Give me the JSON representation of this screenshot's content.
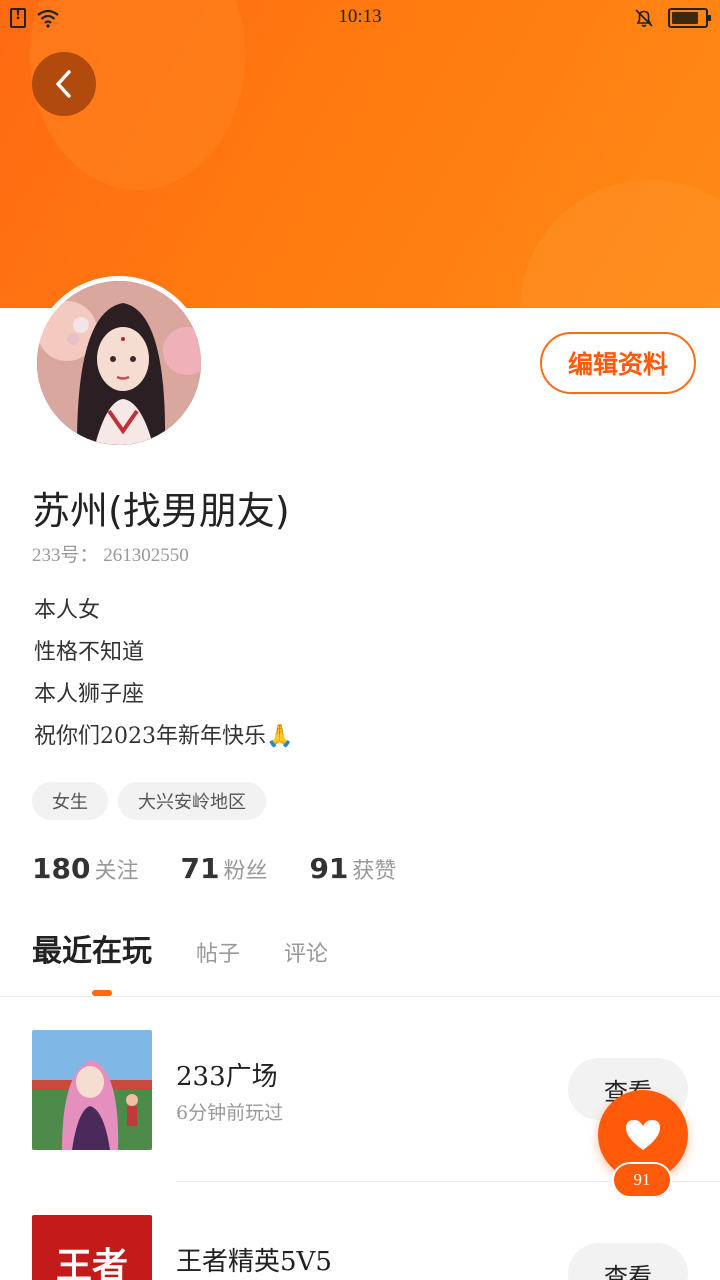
{
  "status_bar": {
    "time": "10:13",
    "icons": [
      "sim-alert-icon",
      "wifi-icon",
      "bell-off-icon",
      "battery-icon"
    ],
    "battery_level": 0.8
  },
  "colors": {
    "brand": "#ff6a13",
    "accent": "#ff5a0a"
  },
  "header": {
    "back_icon": "chevron-left-icon"
  },
  "profile": {
    "name": "苏州(找男朋友)",
    "id_line": "233号：  261302550",
    "edit_label": "编辑资料",
    "bio": [
      "本人女",
      "性格不知道",
      "本人狮子座",
      "祝你们2023年新年快乐"
    ],
    "bio_emoji": "🙏",
    "tags": [
      "女生",
      "大兴安岭地区"
    ]
  },
  "stats": [
    {
      "num": "180",
      "label": "关注"
    },
    {
      "num": "71",
      "label": "粉丝"
    },
    {
      "num": "91",
      "label": "获赞"
    }
  ],
  "tabs": [
    {
      "label": "最近在玩",
      "active": true
    },
    {
      "label": "帖子",
      "active": false
    },
    {
      "label": "评论",
      "active": false
    }
  ],
  "games": [
    {
      "title": "233广场",
      "subtitle": "6分钟前玩过",
      "button": "查看"
    },
    {
      "title": "王者精英5V5",
      "subtitle": "",
      "button": "查看",
      "thumb_text": "王者"
    }
  ],
  "like": {
    "icon": "heart-icon",
    "count": "91"
  }
}
